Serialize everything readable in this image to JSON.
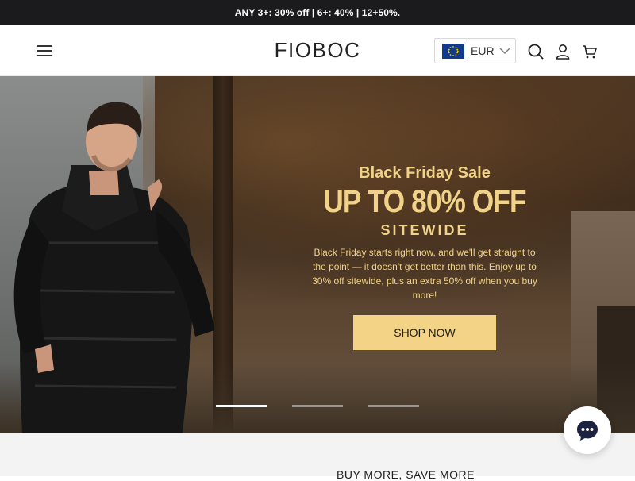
{
  "announcement": {
    "text": "ANY 3+: 30% off | 6+: 40% | 12+50%."
  },
  "header": {
    "logo": "FIOBOC",
    "currency": {
      "label": "EUR",
      "flag": "eu-flag-icon"
    },
    "icons": [
      "menu-icon",
      "search-icon",
      "account-icon",
      "cart-icon"
    ]
  },
  "hero": {
    "subtitle": "Black Friday Sale",
    "headline": "UP TO 80% OFF",
    "tagline": "SITEWIDE",
    "body": "Black Friday starts right now, and we'll get straight to the point — it doesn't get better than this. Enjoy up to 30% off sitewide, plus an extra 50% off when you buy more!",
    "cta": "SHOP NOW",
    "accent": "#f0d288",
    "slides": 3,
    "active_slide": 1
  },
  "section": {
    "title": "BUY MORE, SAVE MORE"
  }
}
